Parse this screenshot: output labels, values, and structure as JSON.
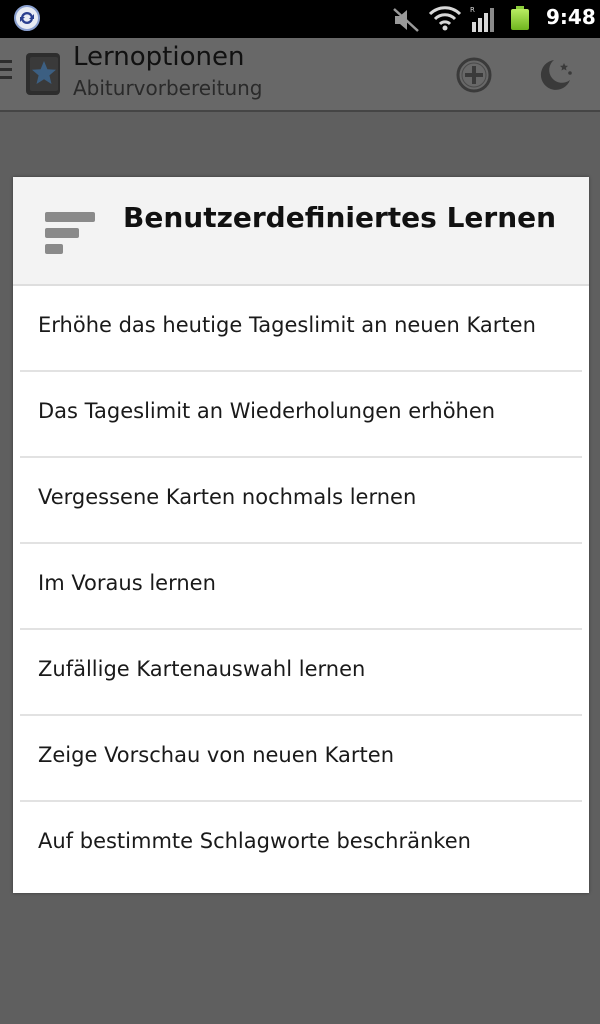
{
  "status_bar": {
    "time": "9:48",
    "icons": [
      "sync-icon",
      "mute-icon",
      "wifi-icon",
      "signal-icon",
      "battery-icon"
    ],
    "battery_color": "#8ccf3a"
  },
  "action_bar": {
    "title": "Lernoptionen",
    "subtitle": "Abiturvorbereitung",
    "icons": [
      "menu-icon",
      "app-logo",
      "add-icon",
      "night-mode-icon"
    ]
  },
  "dialog": {
    "title": "Benutzerdefiniertes Lernen",
    "icon": "custom-study-icon",
    "items": [
      {
        "label": "Erhöhe das heutige Tageslimit an neuen Karten"
      },
      {
        "label": "Das Tageslimit an Wiederholungen erhöhen"
      },
      {
        "label": "Vergessene Karten nochmals lernen"
      },
      {
        "label": "Im Voraus lernen"
      },
      {
        "label": "Zufällige Kartenauswahl lernen"
      },
      {
        "label": "Zeige Vorschau von neuen Karten"
      },
      {
        "label": "Auf bestimmte Schlagworte beschränken"
      }
    ]
  }
}
